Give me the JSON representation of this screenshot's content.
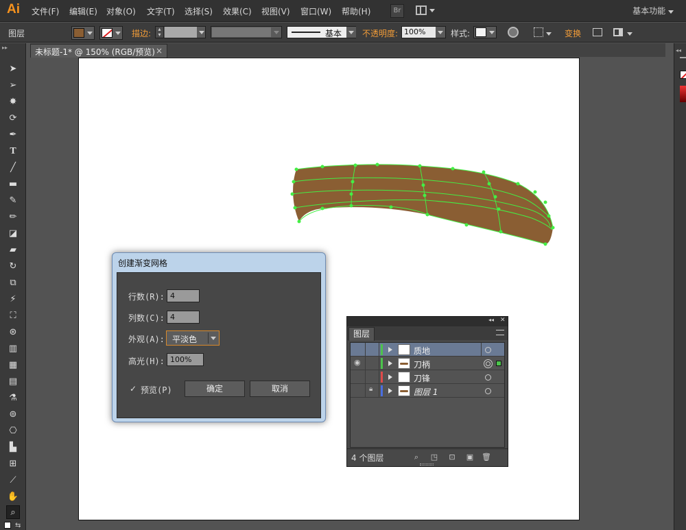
{
  "app": {
    "logo": "Ai",
    "workspace": "基本功能"
  },
  "menu": [
    "文件(F)",
    "编辑(E)",
    "对象(O)",
    "文字(T)",
    "选择(S)",
    "效果(C)",
    "视图(V)",
    "窗口(W)",
    "帮助(H)"
  ],
  "menu_icons": {
    "bridge": "Br"
  },
  "control": {
    "panel_label": "图层",
    "stroke_label": "描边:",
    "stroke_profile": "基本",
    "opacity_label": "不透明度:",
    "opacity_value": "100%",
    "style_label": "样式:",
    "transform_label": "变换",
    "fill_color": "#8a5e33"
  },
  "document": {
    "tab_title": "未标题-1* @ 150% (RGB/预览)",
    "close": "×"
  },
  "dialog": {
    "title": "创建渐变网格",
    "rows_label": "行数(R):",
    "rows_value": "4",
    "cols_label": "列数(C):",
    "cols_value": "4",
    "appearance_label": "外观(A):",
    "appearance_value": "平淡色",
    "highlight_label": "高光(H):",
    "highlight_value": "100%",
    "preview_label": "预览(P)",
    "preview_checked": true,
    "ok": "确定",
    "cancel": "取消"
  },
  "layers_panel": {
    "tab": "图层",
    "collapse": "◂◂",
    "close": "✕",
    "rows": [
      {
        "name": "质地",
        "color": "#4cc44c",
        "selected": true
      },
      {
        "name": "刀柄",
        "color": "#4cc44c",
        "visible": true
      },
      {
        "name": "刀锋",
        "color": "#e04a4a"
      },
      {
        "name": "图层 1",
        "color": "#4a6ee0",
        "locked": true
      }
    ],
    "footer": "4 个图层"
  },
  "artwork": {
    "fill": "#8a5e33",
    "mesh_color": "#44ee44"
  }
}
